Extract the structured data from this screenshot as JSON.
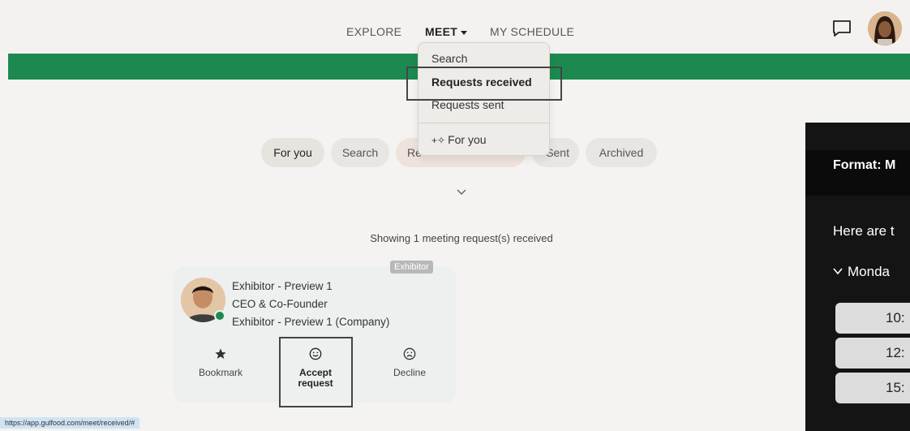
{
  "nav": {
    "explore": "EXPLORE",
    "meet": "MEET",
    "schedule": "MY SCHEDULE"
  },
  "dropdown": {
    "search": "Search",
    "received": "Requests received",
    "sent": "Requests sent",
    "for_you": "For you"
  },
  "filters": {
    "for_you": "For you",
    "search": "Search",
    "requests_partial": "Re",
    "sent_partial": "Sent",
    "archived": "Archived"
  },
  "showing_text": "Showing 1 meeting request(s) received",
  "card": {
    "badge": "Exhibitor",
    "name": "Exhibitor - Preview 1",
    "title": "CEO & Co-Founder",
    "company": "Exhibitor - Preview 1 (Company)",
    "bookmark": "Bookmark",
    "accept_line1": "Accept",
    "accept_line2": "request",
    "decline": "Decline"
  },
  "status_url": "https://app.gulfood.com/meet/received/#",
  "side_panel": {
    "format": "Format: M",
    "here": "Here are t",
    "day": "Monda",
    "times": [
      "10:",
      "12:",
      "15:"
    ]
  },
  "colors": {
    "brand_green": "#1c8a50",
    "dark_panel": "#141414"
  }
}
